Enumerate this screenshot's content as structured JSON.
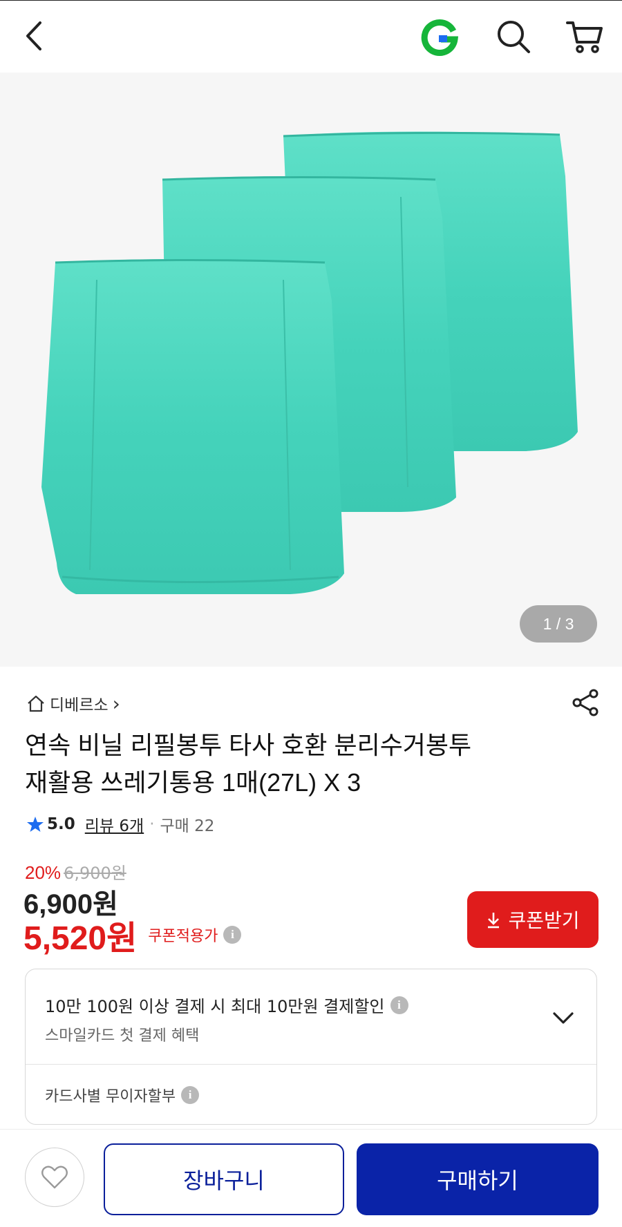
{
  "header": {
    "back_icon": "chevron-left-icon",
    "logo_letter": "G",
    "logo_color": "#16b53a",
    "search_icon": "search-icon",
    "cart_icon": "cart-icon"
  },
  "gallery": {
    "image_desc_icon": "product-image",
    "product_color": "#49d6bd",
    "current": "1",
    "total": "3",
    "separator": "/"
  },
  "product": {
    "seller": "디베르소",
    "seller_chevron": "›",
    "title_line1": "연속 비닐 리필봉투 타사 호환 분리수거봉투",
    "title_line2": "재활용 쓰레기통용 1매(27L) X 3",
    "rating": "5.0",
    "reviews": "리뷰 6개",
    "purchases": "구매 22",
    "dot": "·"
  },
  "pricing": {
    "discount_rate": "20%",
    "original_price": "6,900원",
    "price": "6,900원",
    "coupon_price": "5,520원",
    "coupon_label": "쿠폰적용가",
    "coupon_button": "쿠폰받기",
    "accent_red": "#e01c1c"
  },
  "benefits": {
    "main": "10만 100원 이상 결제 시 최대 10만원 결제할인",
    "sub": "스마일카드 첫 결제 혜택",
    "installment": "카드사별 무이자할부",
    "info_glyph": "i"
  },
  "actions": {
    "add_to_cart": "장바구니",
    "buy": "구매하기",
    "wish_icon": "heart-icon",
    "brand_blue": "#0a23a8"
  }
}
